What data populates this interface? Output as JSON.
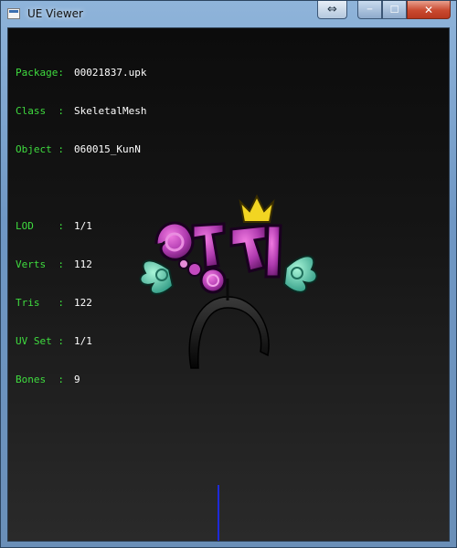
{
  "window": {
    "title": "UE Viewer"
  },
  "titlebar_buttons": {
    "swap": "⇔",
    "minimize": "─",
    "maximize": "☐",
    "close": "✕"
  },
  "info": {
    "package": {
      "label": "Package:",
      "value": "00021837.upk"
    },
    "class": {
      "label": "Class  :",
      "value": "SkeletalMesh"
    },
    "object": {
      "label": "Object :",
      "value": "060015_KunN"
    },
    "lod": {
      "label": "LOD    :",
      "value": "1/1"
    },
    "verts": {
      "label": "Verts  :",
      "value": "112"
    },
    "tris": {
      "label": "Tris   :",
      "value": "122"
    },
    "uvset": {
      "label": "UV Set :",
      "value": "1/1"
    },
    "bones": {
      "label": "Bones  :",
      "value": "9"
    }
  },
  "model": {
    "text": "엽자"
  },
  "colors": {
    "label_green": "#3fdc3f",
    "value_white": "#ffffff",
    "axis_blue": "#1e2ad8"
  }
}
